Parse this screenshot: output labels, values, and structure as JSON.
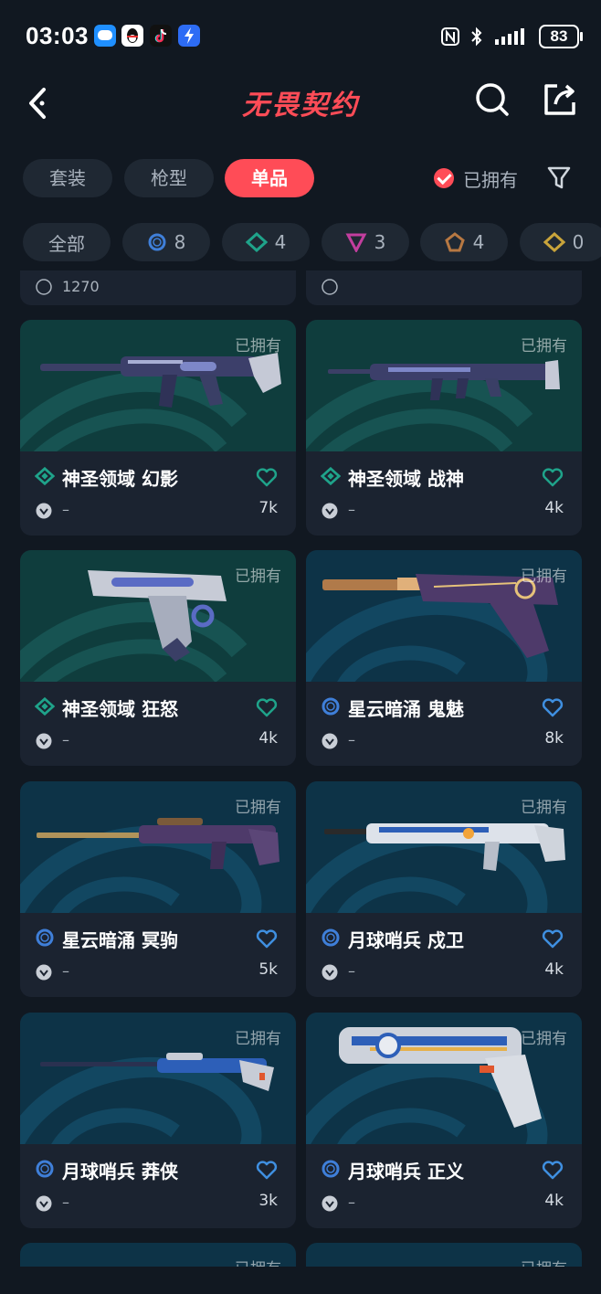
{
  "status_bar": {
    "time": "03:03",
    "apps": [
      "chat-app-icon",
      "qq-icon",
      "tiktok-icon",
      "lightning-app-icon"
    ],
    "battery": "83",
    "icons": [
      "nfc-icon",
      "bluetooth-icon",
      "signal-icon"
    ]
  },
  "header": {
    "title": "无畏契约",
    "back_icon": "chevron-left-icon",
    "search_icon": "search-icon",
    "share_icon": "share-icon"
  },
  "tabs": [
    {
      "label": "套装",
      "active": false
    },
    {
      "label": "枪型",
      "active": false
    },
    {
      "label": "单品",
      "active": true
    }
  ],
  "owned_filter": {
    "label": "已拥有",
    "checked": true
  },
  "rarity_chips": [
    {
      "label": "全部"
    },
    {
      "icon": "ring-tier-icon",
      "count": "8",
      "color": "#3f7fd9"
    },
    {
      "icon": "diamond-tier-icon",
      "count": "4",
      "color": "#1fa38a"
    },
    {
      "icon": "triangle-tier-icon",
      "count": "3",
      "color": "#c23e9e"
    },
    {
      "icon": "pentagon-tier-icon",
      "count": "4",
      "color": "#b77842"
    },
    {
      "icon": "gold-diamond-tier-icon",
      "count": "0",
      "color": "#c9a43b"
    }
  ],
  "partial_top": {
    "left_value": "1270"
  },
  "items": [
    {
      "name": "神圣领域 幻影",
      "tier": "diamond",
      "owned": "已拥有",
      "sub": "–",
      "favs": "7k",
      "bg": "teal"
    },
    {
      "name": "神圣领域 战神",
      "tier": "diamond",
      "owned": "已拥有",
      "sub": "–",
      "favs": "4k",
      "bg": "teal"
    },
    {
      "name": "神圣领域 狂怒",
      "tier": "diamond",
      "owned": "已拥有",
      "sub": "–",
      "favs": "4k",
      "bg": "teal"
    },
    {
      "name": "星云暗涌 鬼魅",
      "tier": "ring",
      "owned": "已拥有",
      "sub": "–",
      "favs": "8k",
      "bg": "blue"
    },
    {
      "name": "星云暗涌 冥驹",
      "tier": "ring",
      "owned": "已拥有",
      "sub": "–",
      "favs": "5k",
      "bg": "blue"
    },
    {
      "name": "月球哨兵 戍卫",
      "tier": "ring",
      "owned": "已拥有",
      "sub": "–",
      "favs": "4k",
      "bg": "blue"
    },
    {
      "name": "月球哨兵 莽侠",
      "tier": "ring",
      "owned": "已拥有",
      "sub": "–",
      "favs": "3k",
      "bg": "blue"
    },
    {
      "name": "月球哨兵 正义",
      "tier": "ring",
      "owned": "已拥有",
      "sub": "–",
      "favs": "4k",
      "bg": "blue"
    }
  ],
  "partial_bottom": {
    "left_owned": "已拥有",
    "right_owned": "已拥有"
  }
}
